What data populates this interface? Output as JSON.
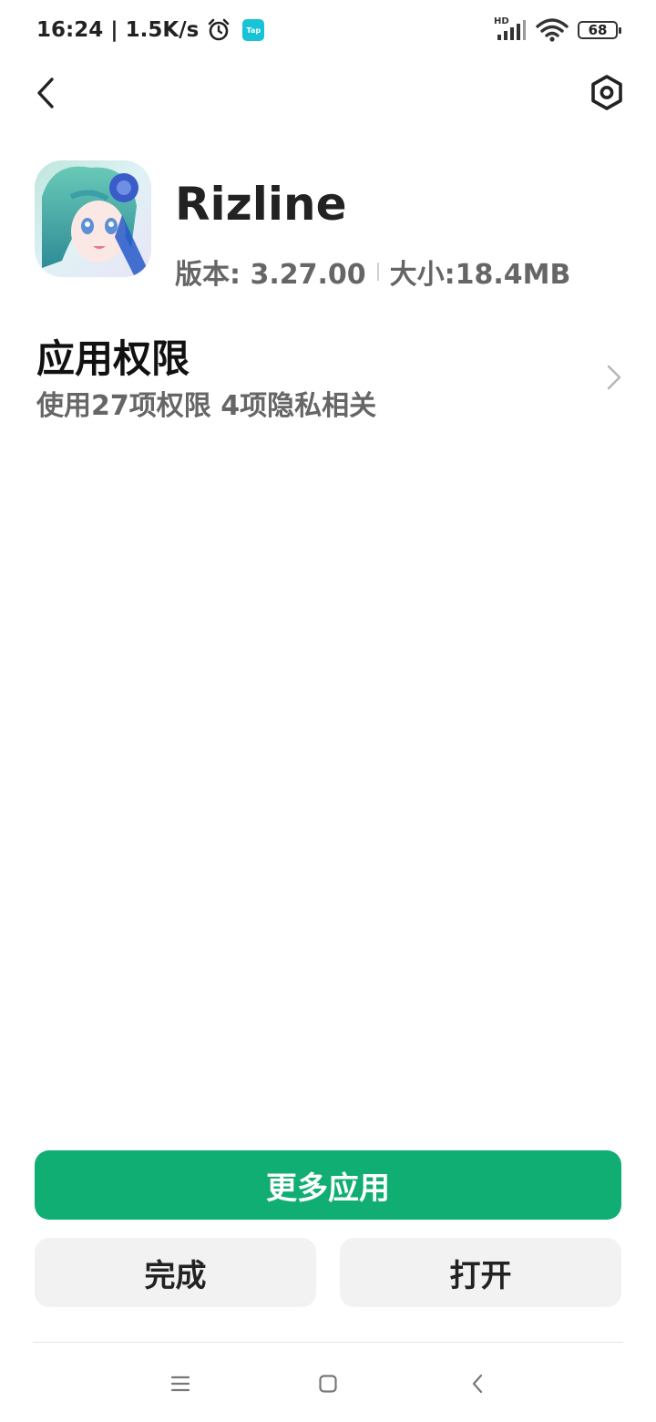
{
  "status_bar": {
    "time": "16:24",
    "separator": "|",
    "net_speed": "1.5K/s",
    "tap_label": "Tap",
    "network_label": "HD",
    "battery": "68",
    "icons": [
      "alarm-icon",
      "tap-app-icon",
      "signal-icon",
      "wifi-icon",
      "battery-icon"
    ]
  },
  "nav": {
    "back_icon": "chevron-left-icon",
    "settings_icon": "settings-hexagon-icon"
  },
  "app": {
    "name": "Rizline",
    "version_label": "版本: 3.27.00",
    "size_label": "大小:18.4MB"
  },
  "permissions": {
    "title": "应用权限",
    "subtitle": "使用27项权限  4项隐私相关"
  },
  "buttons": {
    "more_apps": "更多应用",
    "done": "完成",
    "open": "打开"
  },
  "colors": {
    "primary_green": "#10ae72",
    "secondary_button_bg": "#f2f2f2",
    "tap_cyan": "#18c3d6"
  },
  "system_nav": {
    "icons": [
      "menu-icon",
      "home-icon",
      "back-icon"
    ]
  }
}
